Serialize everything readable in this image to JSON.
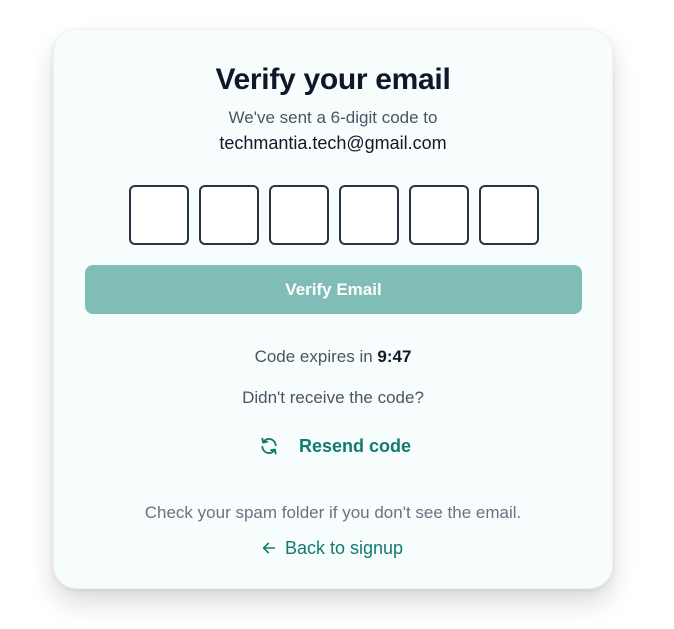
{
  "card": {
    "title": "Verify your email",
    "subtitle": "We've sent a 6-digit code to",
    "email": "techmantia.tech@gmail.com"
  },
  "otp": {
    "digits": [
      "",
      "",
      "",
      "",
      "",
      ""
    ]
  },
  "verify_button": {
    "label": "Verify Email",
    "color": "#7fbdb6"
  },
  "expiry": {
    "label": "Code expires in ",
    "time": "9:47"
  },
  "resend": {
    "prompt": "Didn't receive the code?",
    "label": "Resend code",
    "icon": "refresh-icon",
    "color": "#137a70"
  },
  "footer": {
    "spam_note": "Check your spam folder if you don't see the email.",
    "back_label": "Back to signup",
    "back_icon": "arrow-left-icon"
  }
}
